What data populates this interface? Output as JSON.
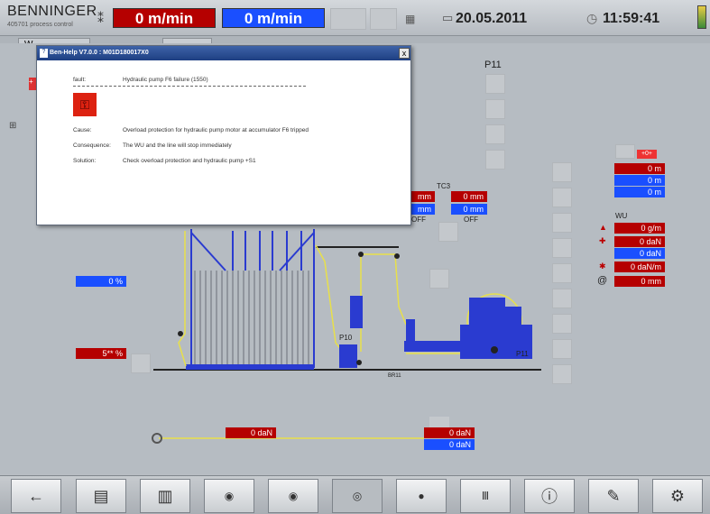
{
  "header": {
    "brand": "BENNINGER",
    "brand_sub": "405701 process control",
    "speed_red": "0 m/min",
    "speed_blue": "0 m/min",
    "date": "20.05.2011",
    "time": "11:59:41"
  },
  "tabs": [
    "W"
  ],
  "dialog": {
    "title": "Ben-Help V7.0.0 : M01D180017X0",
    "close_label": "x",
    "fault_label": "fault:",
    "fault_value": "Hydraulic pump F6 failure (1550)",
    "cause_label": "Cause:",
    "cause_value": "Overload protection for hydraulic pump motor at accumulator F6 tripped",
    "consequence_label": "Consequence:",
    "consequence_value": "The WU and the line will stop immediately",
    "solution_label": "Solution:",
    "solution_value": "Check overload protection and hydraulic pump +S1"
  },
  "process": {
    "p11": "P11",
    "tc3": "TC3",
    "tc3_m1": "0 mm",
    "tc3_m2": "0 mm",
    "left_m1": "mm",
    "left_m2": "mm",
    "off1": "OFF",
    "off2": "OFF",
    "wu": "WU",
    "right_badge": "+0+",
    "right_vals": [
      "0 m",
      "0 m",
      "0 m"
    ],
    "wu_vals": [
      "0 g/m",
      "0 daN",
      "0 daN",
      "0 daN/m",
      "0 mm"
    ],
    "pct_blue": "0 %",
    "pct_red": "5** %",
    "p10": "P10",
    "p11b": "P11",
    "br": "BR11",
    "daN_red": "0 daN",
    "daN_red2": "0 daN",
    "daN_blue": "0 daN"
  },
  "toolbar": {
    "buttons": [
      {
        "name": "back-button",
        "glyph": "←"
      },
      {
        "name": "document-button",
        "glyph": "▤"
      },
      {
        "name": "machine-button",
        "glyph": "▥"
      },
      {
        "name": "roller-button-1",
        "glyph": "◉"
      },
      {
        "name": "roller-button-2",
        "glyph": "◉"
      },
      {
        "name": "roller-button-3",
        "glyph": "◎"
      },
      {
        "name": "roller-button-4",
        "glyph": "●"
      },
      {
        "name": "heater-button",
        "glyph": "Ⅲ"
      },
      {
        "name": "info-button",
        "glyph": "ⓘ"
      },
      {
        "name": "tools-button",
        "glyph": "✎"
      },
      {
        "name": "settings-button",
        "glyph": "⚙"
      }
    ]
  },
  "colors": {
    "red": "#b50000",
    "blue": "#1a4fff",
    "yellow": "#e8e04a",
    "machine": "#2a3bd0"
  }
}
